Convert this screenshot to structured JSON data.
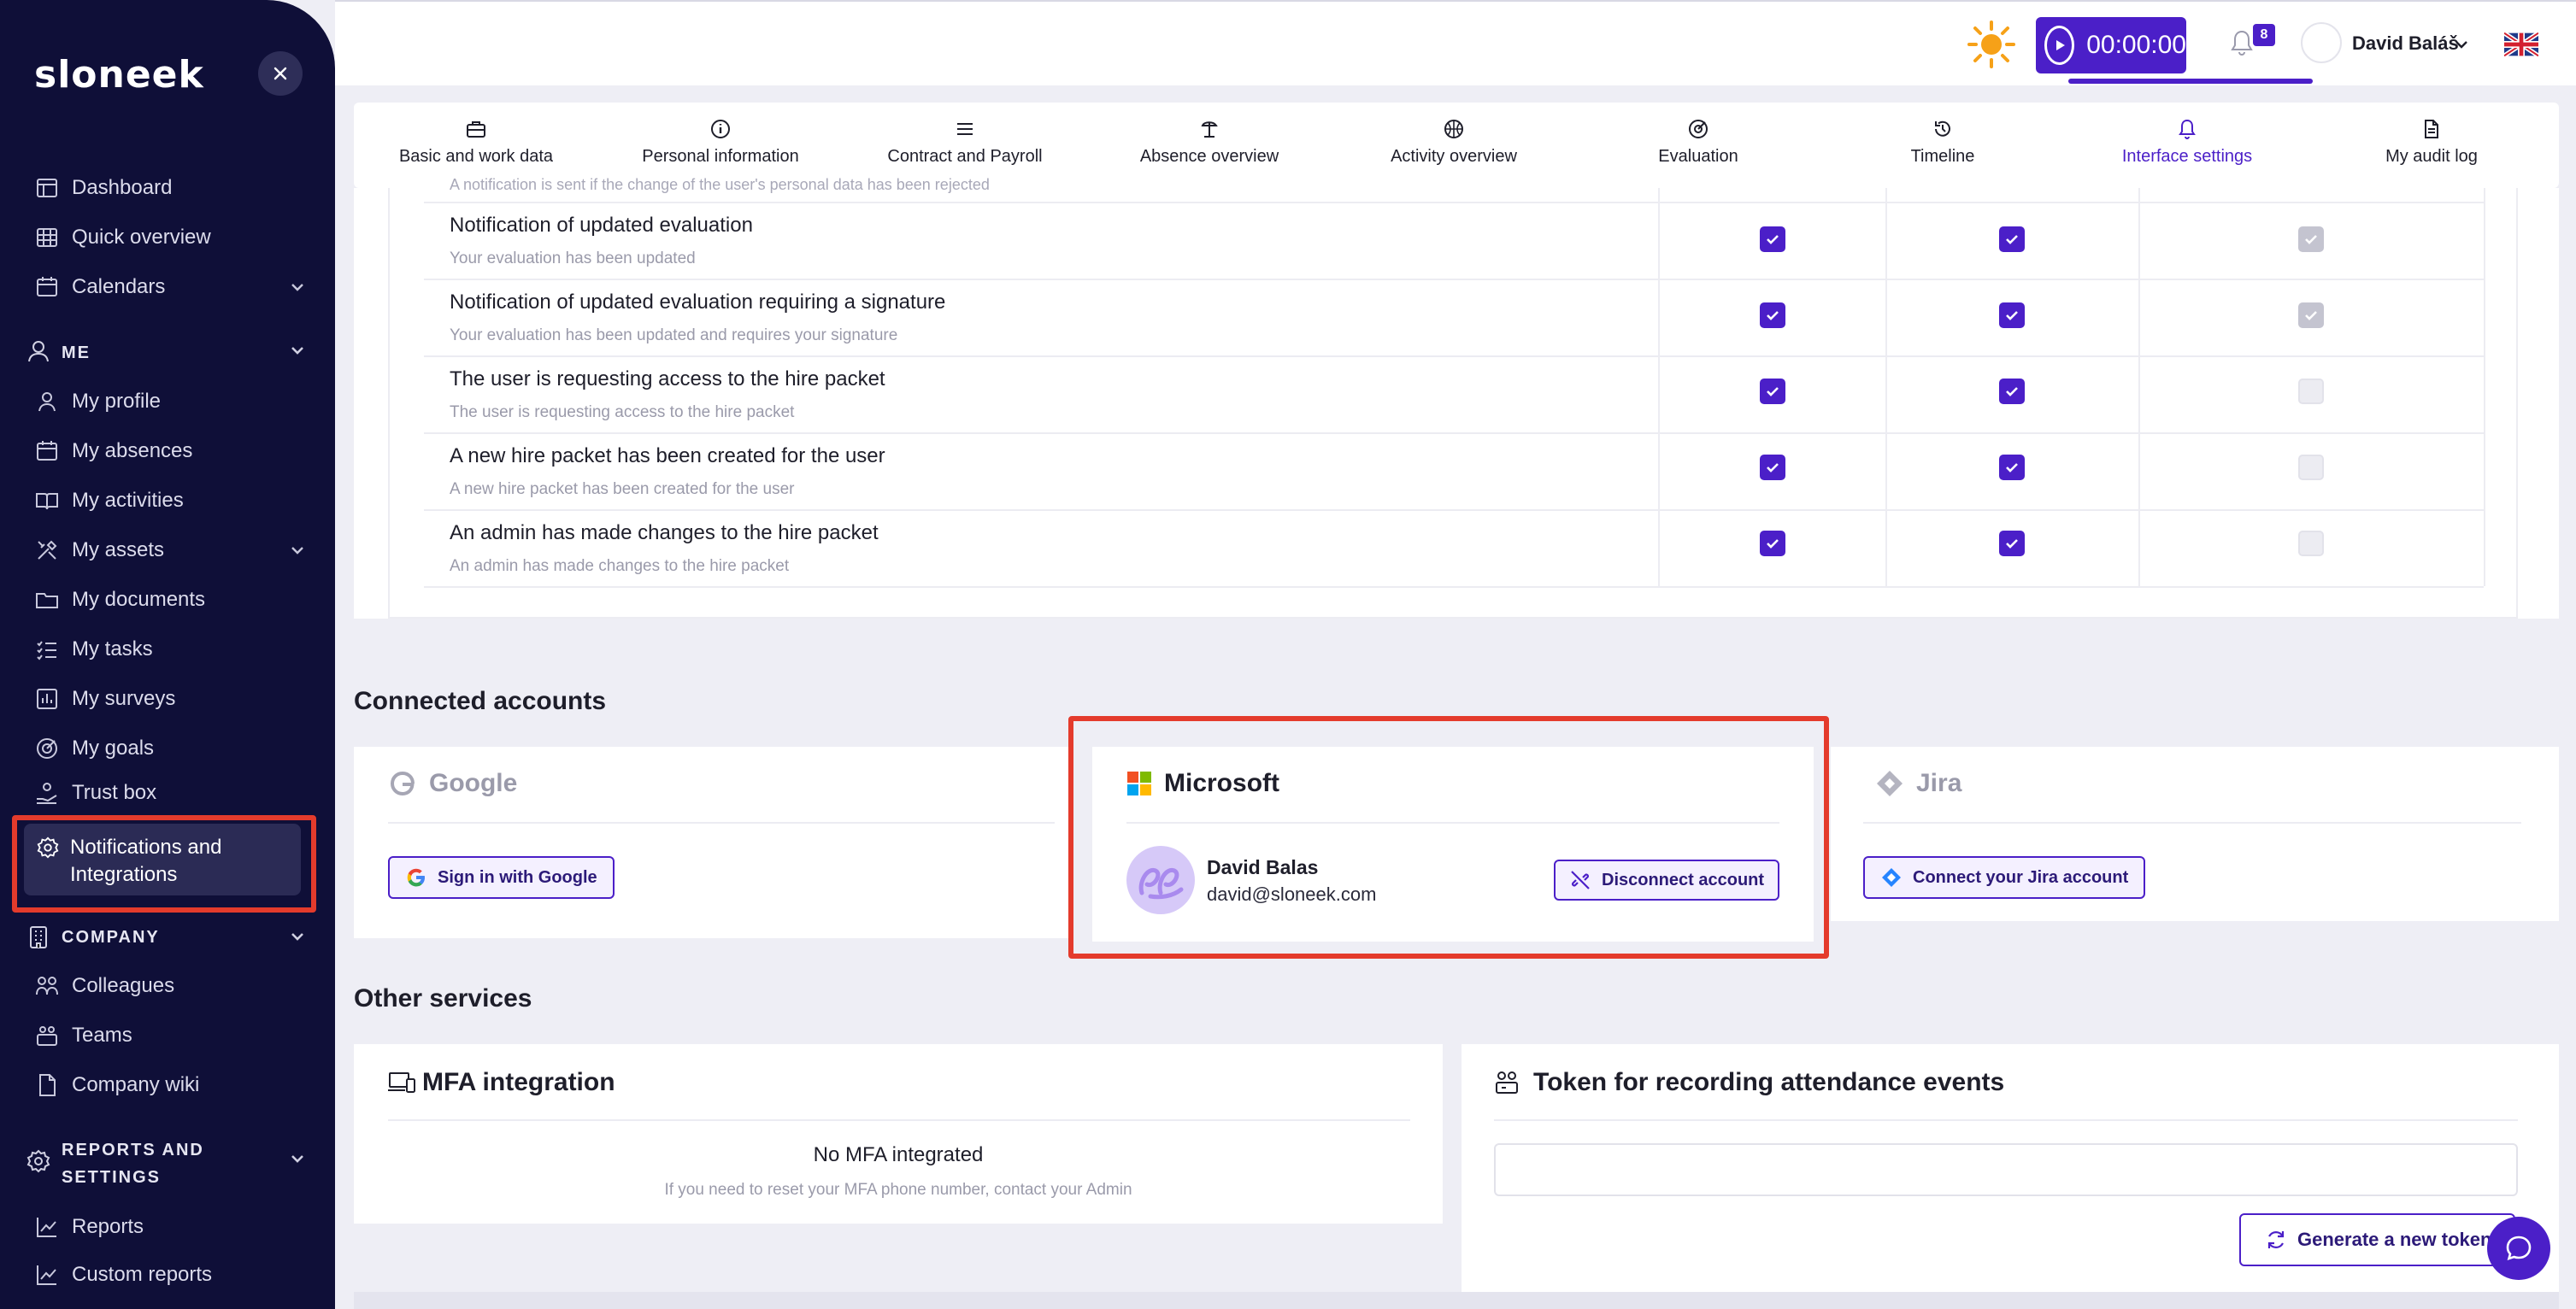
{
  "sidebar": {
    "logo": "sloneek",
    "items": {
      "dashboard": "Dashboard",
      "quick_overview": "Quick overview",
      "calendars": "Calendars",
      "my_profile": "My profile",
      "my_absences": "My absences",
      "my_activities": "My activities",
      "my_assets": "My assets",
      "my_documents": "My documents",
      "my_tasks": "My tasks",
      "my_surveys": "My surveys",
      "my_goals": "My goals",
      "trust_box": "Trust box",
      "notifications_1": "Notifications and",
      "notifications_2": "Integrations",
      "colleagues": "Colleagues",
      "teams": "Teams",
      "company_wiki": "Company wiki",
      "reports": "Reports",
      "custom_reports": "Custom reports"
    },
    "sections": {
      "me": "ME",
      "company": "COMPANY",
      "reports_1": "REPORTS AND",
      "reports_2": "SETTINGS"
    }
  },
  "topbar": {
    "timer": "00:00:00",
    "notification_count": "8",
    "user_name": "David Baláš"
  },
  "tabs": [
    {
      "label": "Basic and work data",
      "icon": "briefcase-icon"
    },
    {
      "label": "Personal information",
      "icon": "info-icon"
    },
    {
      "label": "Contract and Payroll",
      "icon": "list-icon"
    },
    {
      "label": "Absence overview",
      "icon": "beach-icon"
    },
    {
      "label": "Activity overview",
      "icon": "basketball-icon"
    },
    {
      "label": "Evaluation",
      "icon": "target-icon"
    },
    {
      "label": "Timeline",
      "icon": "history-icon"
    },
    {
      "label": "Interface settings",
      "icon": "bell-icon"
    },
    {
      "label": "My audit log",
      "icon": "document-icon"
    }
  ],
  "notifications": {
    "cut_off_text": "A notification is sent if the change of the user's personal data has been rejected",
    "rows": [
      {
        "title": "Notification of updated evaluation",
        "sub": "Your evaluation has been updated",
        "c1": true,
        "c2": true,
        "c3": "disabled-checked"
      },
      {
        "title": "Notification of updated evaluation requiring a signature",
        "sub": "Your evaluation has been updated and requires your signature",
        "c1": true,
        "c2": true,
        "c3": "disabled-checked"
      },
      {
        "title": "The user is requesting access to the hire packet",
        "sub": "The user is requesting access to the hire packet",
        "c1": true,
        "c2": true,
        "c3": "disabled-unchecked"
      },
      {
        "title": "A new hire packet has been created for the user",
        "sub": "A new hire packet has been created for the user",
        "c1": true,
        "c2": true,
        "c3": "disabled-unchecked"
      },
      {
        "title": "An admin has made changes to the hire packet",
        "sub": "An admin has made changes to the hire packet",
        "c1": true,
        "c2": true,
        "c3": "disabled-unchecked"
      }
    ]
  },
  "connected_accounts": {
    "title": "Connected accounts",
    "google": {
      "name": "Google",
      "button": "Sign in with Google"
    },
    "microsoft": {
      "name": "Microsoft",
      "user_name": "David Balas",
      "email": "david@sloneek.com",
      "button": "Disconnect account"
    },
    "jira": {
      "name": "Jira",
      "button": "Connect your Jira account"
    }
  },
  "other_services": {
    "title": "Other services",
    "mfa": {
      "title": "MFA integration",
      "empty_title": "No MFA integrated",
      "empty_sub": "If you need to reset your MFA phone number, contact your Admin"
    },
    "token": {
      "title": "Token for recording attendance events",
      "input_value": "",
      "button": "Generate a new token"
    }
  },
  "colors": {
    "accent": "#4b1fc8",
    "sidebar_bg": "#0f0f38",
    "highlight": "#e43b2c"
  }
}
